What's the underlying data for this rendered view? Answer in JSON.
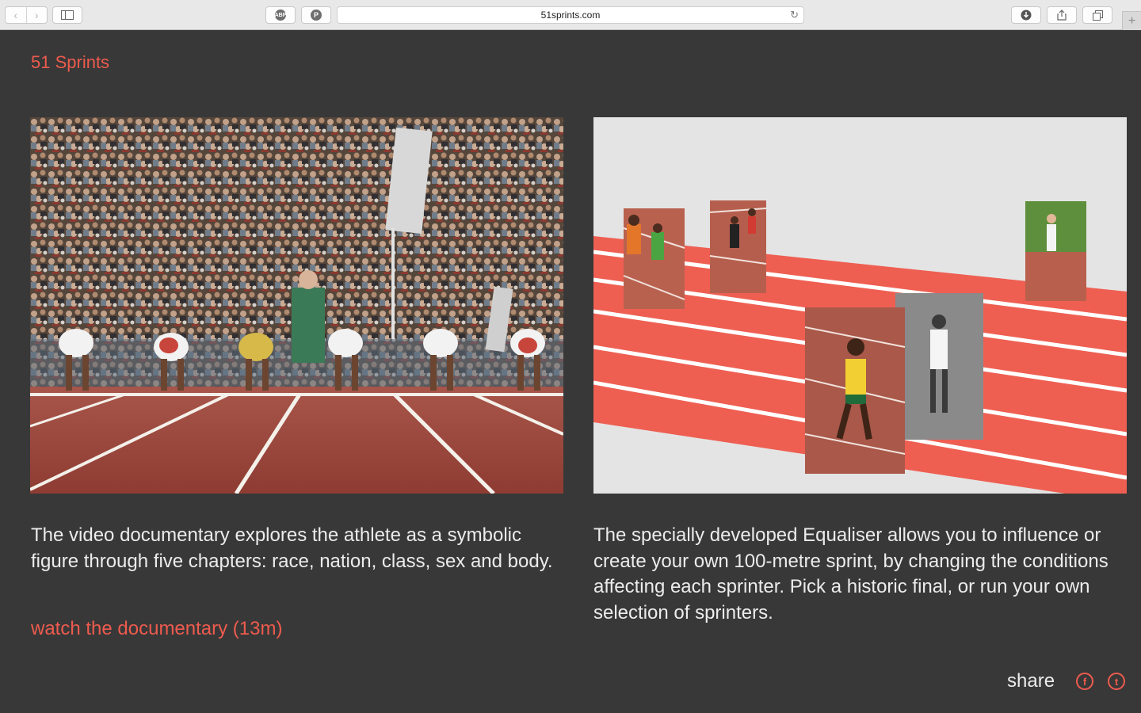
{
  "browser": {
    "url": "51sprints.com",
    "back_glyph": "‹",
    "forward_glyph": "›",
    "abp_label": "ABP",
    "pinterest_label": "P",
    "reload_glyph": "↻",
    "new_tab_glyph": "+"
  },
  "site": {
    "logo": "51 Sprints",
    "accent_color": "#ee5b4e",
    "background_color": "#383838"
  },
  "left_panel": {
    "image_alt": "Sprinters crouched in starting blocks in front of a packed stadium crowd",
    "description": "The video documentary explores the athlete as a symbolic figure through five chapters: race, nation, class, sex and body.",
    "link_label": "watch the documentary (13m)"
  },
  "right_panel": {
    "image_alt": "Equaliser illustration: red running track with photo cut-outs of sprinters",
    "description": "The specially developed Equaliser allows you to influence or create your own 100-metre sprint, by changing the conditions affecting each sprinter. Pick a historic final, or run your own selection of sprinters."
  },
  "footer": {
    "share_label": "share",
    "facebook_glyph": "f",
    "twitter_glyph": "t"
  }
}
